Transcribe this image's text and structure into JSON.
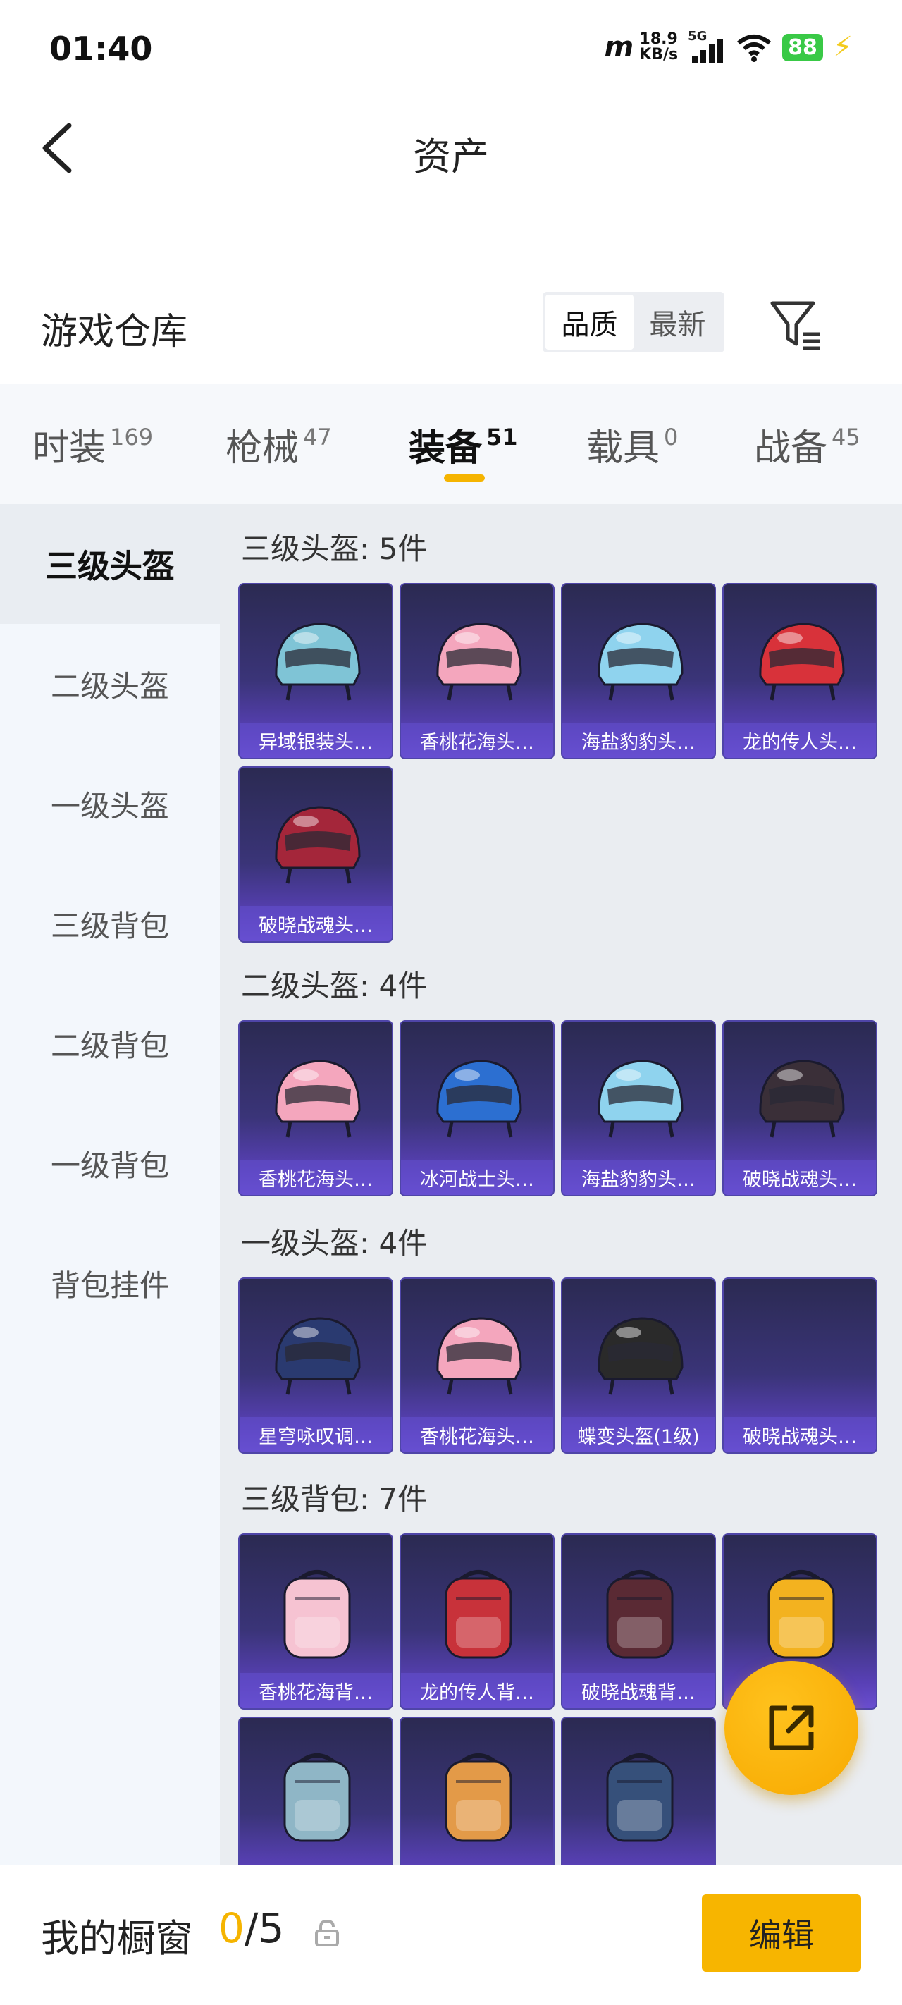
{
  "status_bar": {
    "time": "01:40",
    "net_logo": "m",
    "speed_value": "18.9",
    "speed_unit": "KB/s",
    "signal_label": "5G",
    "battery": "88"
  },
  "header": {
    "title": "资产"
  },
  "warehouse": {
    "title": "游戏仓库",
    "sort_quality": "品质",
    "sort_newest": "最新"
  },
  "tabs": [
    {
      "label": "时装",
      "count": "169"
    },
    {
      "label": "枪械",
      "count": "47"
    },
    {
      "label": "装备",
      "count": "51"
    },
    {
      "label": "载具",
      "count": "0"
    },
    {
      "label": "战备",
      "count": "45"
    }
  ],
  "sidebar": [
    {
      "label": "三级头盔"
    },
    {
      "label": "二级头盔"
    },
    {
      "label": "一级头盔"
    },
    {
      "label": "三级背包"
    },
    {
      "label": "二级背包"
    },
    {
      "label": "一级背包"
    },
    {
      "label": "背包挂件"
    }
  ],
  "sections": [
    {
      "title": "三级头盔: 5件",
      "items": [
        {
          "name": "异域银装头…",
          "icon": "helmet-icon",
          "color": "#7fc4d6"
        },
        {
          "name": "香桃花海头…",
          "icon": "helmet-icon",
          "color": "#f4a6bd"
        },
        {
          "name": "海盐豹豹头…",
          "icon": "helmet-icon",
          "color": "#8fd3ee"
        },
        {
          "name": "龙的传人头…",
          "icon": "helmet-icon",
          "color": "#d8323a"
        },
        {
          "name": "破晓战魂头…",
          "icon": "helmet-icon",
          "color": "#a4263a"
        }
      ]
    },
    {
      "title": "二级头盔: 4件",
      "items": [
        {
          "name": "香桃花海头…",
          "icon": "helmet-icon",
          "color": "#f4a6bd"
        },
        {
          "name": "冰河战士头…",
          "icon": "helmet-icon",
          "color": "#2c6fd1"
        },
        {
          "name": "海盐豹豹头…",
          "icon": "helmet-icon",
          "color": "#8fd3ee"
        },
        {
          "name": "破晓战魂头…",
          "icon": "helmet-icon",
          "color": "#3a2f38"
        }
      ]
    },
    {
      "title": "一级头盔: 4件",
      "items": [
        {
          "name": "星穹咏叹调…",
          "icon": "helmet-icon",
          "color": "#2a3a70"
        },
        {
          "name": "香桃花海头…",
          "icon": "helmet-icon",
          "color": "#f4a6bd"
        },
        {
          "name": "蝶变头盔(1级)",
          "icon": "helmet-icon",
          "color": "#2a2a2a"
        },
        {
          "name": "破晓战魂头…",
          "icon": "",
          "color": ""
        }
      ]
    },
    {
      "title": "三级背包: 7件",
      "items": [
        {
          "name": "香桃花海背…",
          "icon": "backpack-icon",
          "color": "#f6c3d2"
        },
        {
          "name": "龙的传人背…",
          "icon": "backpack-icon",
          "color": "#c8323a"
        },
        {
          "name": "破晓战魂背…",
          "icon": "backpack-icon",
          "color": "#5a2a34"
        },
        {
          "name": "",
          "icon": "backpack-icon",
          "color": "#f3b21f"
        },
        {
          "name": "",
          "icon": "backpack-icon",
          "color": "#8fb6c6"
        },
        {
          "name": "",
          "icon": "backpack-icon",
          "color": "#e39a48"
        },
        {
          "name": "",
          "icon": "backpack-icon",
          "color": "#36507a"
        }
      ]
    }
  ],
  "bottom_bar": {
    "showcase_label": "我的橱窗",
    "count_current": "0",
    "count_separator": "/",
    "count_total": "5",
    "edit_label": "编辑"
  },
  "colors": {
    "accent": "#f5b400",
    "card_top": "#2b2a52",
    "card_bottom": "#6a4ed0"
  }
}
